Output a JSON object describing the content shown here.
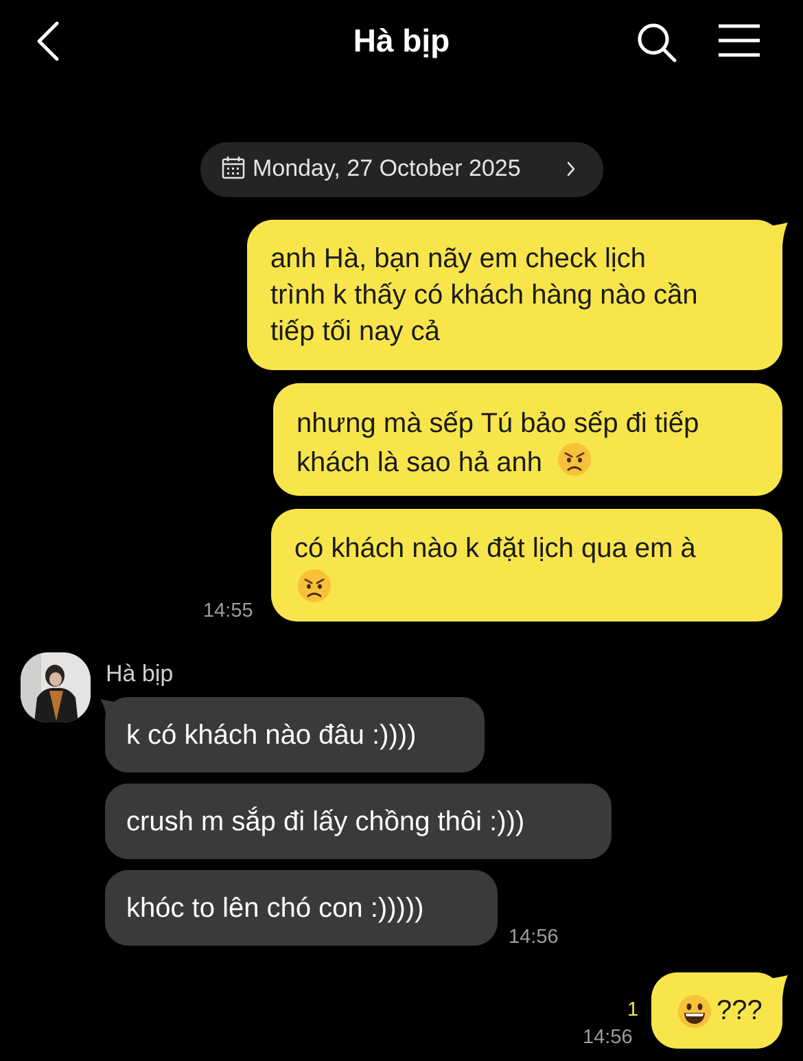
{
  "header": {
    "title": "Hà bịp",
    "back_icon": "chevron-left-icon",
    "search_icon": "search-icon",
    "menu_icon": "hamburger-menu-icon"
  },
  "date_separator": {
    "text": "Monday, 27 October 2025",
    "icon": "calendar-icon",
    "chevron": "chevron-right-icon"
  },
  "colors": {
    "outgoing_bubble": "#f8e54b",
    "incoming_bubble": "#3a3a3c",
    "background": "#000000",
    "timestamp": "#9d9d9d",
    "unread_count": "#f8e54b"
  },
  "messages_out_1": {
    "m1_line1": "anh Hà, bạn nãy em check lịch",
    "m1_line2": "trình k thấy có khách hàng nào cần",
    "m1_line3": "tiếp tối nay cả",
    "m2_line1": "nhưng mà sếp Tú bảo sếp đi tiếp",
    "m2_line2": "khách là sao hả anh",
    "m3_line1": "có khách nào k đặt lịch qua em à",
    "time": "14:55"
  },
  "contact": {
    "name": "Hà bịp",
    "avatar": "avatar"
  },
  "messages_in": {
    "m1": "k có khách nào đâu :))))",
    "m2": "crush m sắp đi lấy chồng thôi :)))",
    "m3": "khóc to lên chó con :)))))",
    "time": "14:56"
  },
  "messages_out_2": {
    "m1": "???",
    "emoji": "grinning-face-emoji",
    "unread": "1",
    "time": "14:56"
  }
}
